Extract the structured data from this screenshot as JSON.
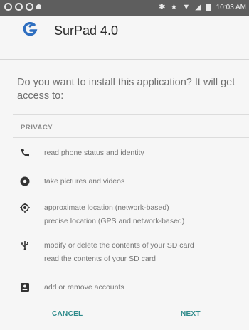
{
  "status_bar": {
    "time": "10:03 AM",
    "icons": [
      "notification-icon",
      "notification-icon",
      "notification-icon",
      "location-icon",
      "bluetooth-icon",
      "star-icon",
      "wifi-icon",
      "signal-icon",
      "battery-icon"
    ]
  },
  "app": {
    "name": "SurPad 4.0",
    "icon": "surpad-app-icon",
    "accent": "#2f6fc0"
  },
  "prompt": "Do you want to install this application? It will get access to:",
  "section": {
    "title": "PRIVACY"
  },
  "permissions": [
    {
      "icon": "phone-icon",
      "lines": [
        "read phone status and identity"
      ]
    },
    {
      "icon": "camera-icon",
      "lines": [
        "take pictures and videos"
      ]
    },
    {
      "icon": "location-icon",
      "lines": [
        "approximate location (network-based)",
        "precise location (GPS and network-based)"
      ]
    },
    {
      "icon": "usb-icon",
      "lines": [
        "modify or delete the contents of your SD card",
        "read the contents of your SD card"
      ]
    },
    {
      "icon": "accounts-icon",
      "lines": [
        "add or remove accounts"
      ]
    }
  ],
  "buttons": {
    "cancel": "CANCEL",
    "next": "NEXT",
    "color": "#2e8b8b"
  }
}
